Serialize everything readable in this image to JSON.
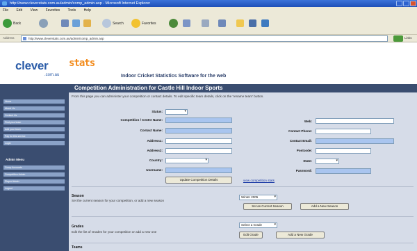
{
  "window": {
    "title": "http://www.cleverstats.com.au/admin/comp_admin.asp - Microsoft Internet Explorer"
  },
  "menu": [
    "File",
    "Edit",
    "View",
    "Favorites",
    "Tools",
    "Help"
  ],
  "toolbar": {
    "back": "Back",
    "search": "Search",
    "favorites": "Favorites"
  },
  "address": {
    "label": "Address",
    "url": "http://www.cleverstats.com.au/admin/comp_admin.asp",
    "go": "Go",
    "links": "Links"
  },
  "logo": {
    "clever": "clever",
    "stats": "stats",
    "domain": ".com.au",
    "tagline": "Indoor Cricket Statistics Software for the web"
  },
  "sidebar": {
    "items": [
      "Home",
      "About Us",
      "Contact Us",
      "Find your team",
      "Add your team",
      "Pay for this service",
      "Login"
    ],
    "admin_heading": "Admin Menu",
    "admin_items": [
      "Comp Accounts",
      "Competition Admin",
      "Player Admin",
      "Logout"
    ]
  },
  "main": {
    "heading": "Competition Administration for Castle Hill Indoor Sports",
    "intro": "From this page you can administer your competition or contact details. To edit specific team details, click on the 'rename team' button.",
    "status_label": "Status:",
    "status_value": "",
    "comp_name_label": "Competition / Centre Name:",
    "comp_name_value": "",
    "contact_name_label": "Contact Name:",
    "contact_name_value": "",
    "address1_label": "Address1:",
    "address1_value": "",
    "address2_label": "Address2:",
    "address2_value": "",
    "country_label": "Country:",
    "country_value": "",
    "username_label": "Username:",
    "username_value": "",
    "web_label": "Web:",
    "web_value": "",
    "contact_phone_label": "Contact Phone:",
    "contact_phone_value": "",
    "contact_email_label": "Contact Email:",
    "contact_email_value": "",
    "postcode_label": "Postcode:",
    "postcode_value": "",
    "state_label": "State:",
    "state_value": "",
    "password_label": "Password:",
    "password_value": "",
    "update_button": "Update Competition Details",
    "view_stats_link": "view competition stats",
    "season": {
      "title": "Season",
      "desc": "Set the current season for your competition, or add a new season",
      "select_value": "Winter 2005",
      "set_button": "Set as Current Season",
      "add_button": "Add a New Season"
    },
    "grades": {
      "title": "Grades",
      "desc": "Edit the list of Grades for your competition or add a new one",
      "select_value": "Select a Grade",
      "edit_button": "Edit Grade",
      "add_button": "Add a New Grade"
    },
    "next_title": "Teams"
  },
  "colors": {
    "banner": "#3a4d70",
    "panel": "#d6dce8",
    "accent_orange": "#f28a1a",
    "logo_blue": "#2b5ca8"
  }
}
